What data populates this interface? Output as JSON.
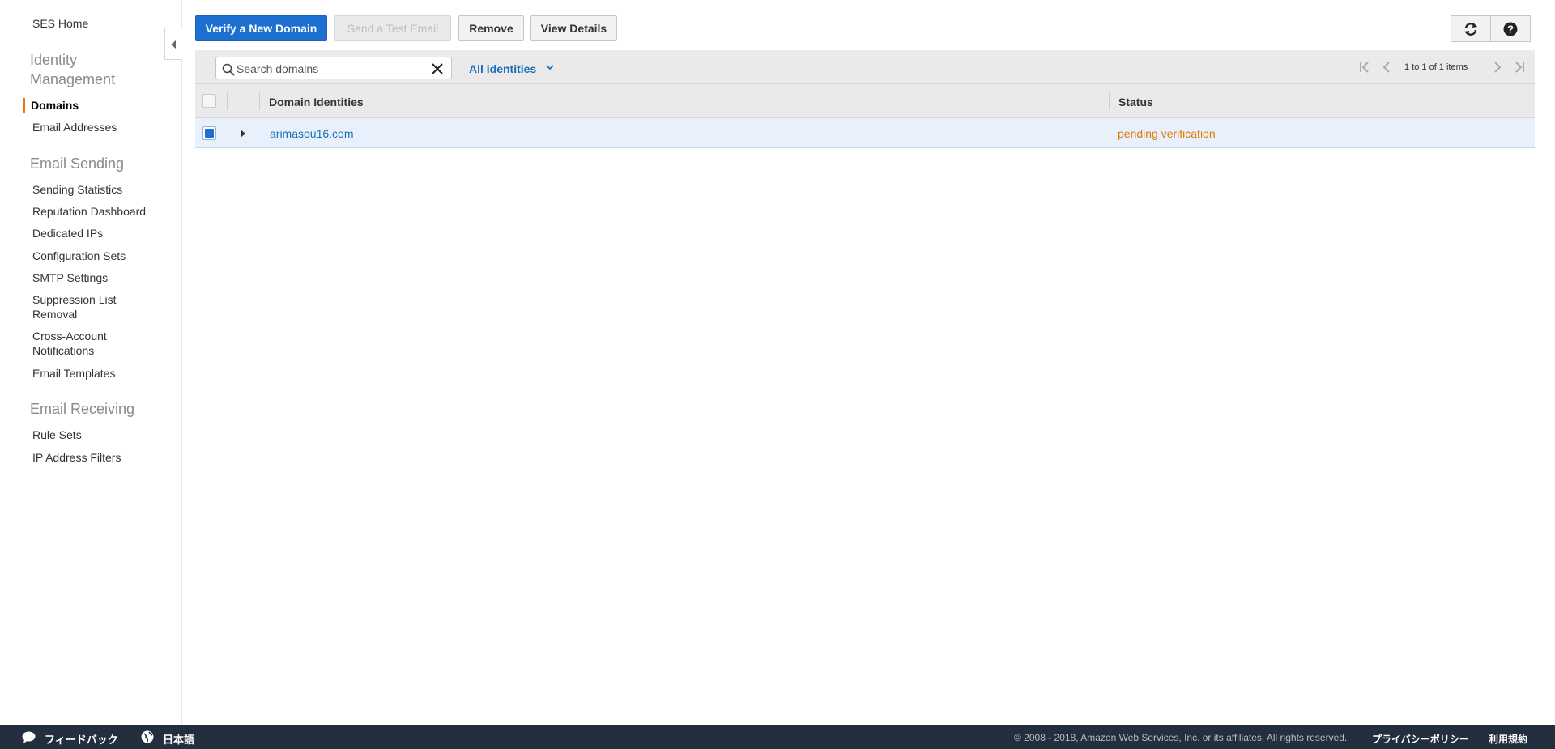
{
  "sidebar": {
    "home_label": "SES Home",
    "sections": [
      {
        "title": "Identity Management",
        "title_line1": "Identity",
        "title_line2": "Management"
      },
      {
        "title": "Email Sending"
      },
      {
        "title": "Email Receiving"
      }
    ],
    "identity_items": [
      {
        "label": "Domains",
        "active": true
      },
      {
        "label": "Email Addresses"
      }
    ],
    "sending_items": [
      {
        "label": "Sending Statistics"
      },
      {
        "label": "Reputation Dashboard"
      },
      {
        "label": "Dedicated IPs"
      },
      {
        "label": "Configuration Sets"
      },
      {
        "label": "SMTP Settings"
      },
      {
        "label_line1": "Suppression List",
        "label_line2": "Removal"
      },
      {
        "label_line1": "Cross-Account",
        "label_line2": "Notifications"
      },
      {
        "label": "Email Templates"
      }
    ],
    "receiving_items": [
      {
        "label": "Rule Sets"
      },
      {
        "label": "IP Address Filters"
      }
    ],
    "active_color": "#ec7211"
  },
  "toolbar": {
    "verify_label": "Verify a New Domain",
    "send_test_label": "Send a Test Email",
    "remove_label": "Remove",
    "view_details_label": "View Details",
    "refresh_icon": "refresh-icon",
    "help_icon": "help-icon",
    "primary_color": "#1d6fd0"
  },
  "filter": {
    "search_placeholder": "Search domains",
    "search_value": "",
    "identity_filter_label": "All identities",
    "pager_text": "1 to 1 of 1 items"
  },
  "table": {
    "columns": [
      "Domain Identities",
      "Status"
    ],
    "rows": [
      {
        "domain": "arimasou16.com",
        "status": "pending verification",
        "selected": true
      }
    ],
    "status_color": "#e07b00",
    "link_color": "#1b6fb8"
  },
  "footer": {
    "feedback_label": "フィードバック",
    "language_label": "日本語",
    "copyright": "© 2008 - 2018, Amazon Web Services, Inc. or its affiliates. All rights reserved.",
    "privacy_label": "プライバシーポリシー",
    "terms_label": "利用規約",
    "background": "#232f3e"
  }
}
